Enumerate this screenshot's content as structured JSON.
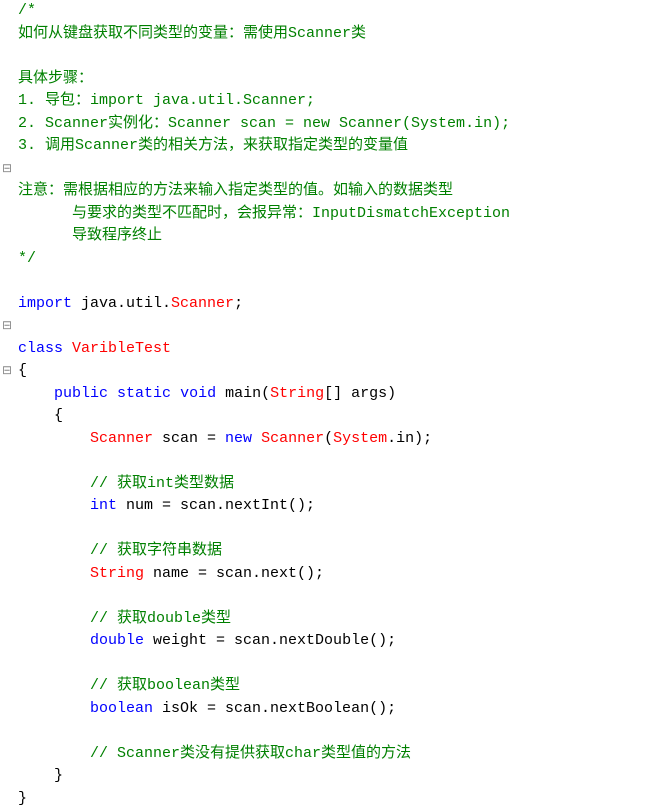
{
  "gutter": [
    "",
    "",
    "",
    "",
    "",
    "",
    "",
    "⊟",
    "",
    "",
    "",
    "",
    "",
    "",
    "⊟",
    "",
    "⊟",
    "",
    "",
    "",
    "",
    "",
    "",
    "",
    "",
    "",
    "",
    "",
    "",
    "",
    "",
    "",
    "",
    "",
    ""
  ],
  "lines": [
    [
      [
        "comment",
        "/*"
      ]
    ],
    [
      [
        "comment",
        "如何从键盘获取不同类型的变量：需使用Scanner类"
      ]
    ],
    [],
    [
      [
        "comment",
        "具体步骤："
      ]
    ],
    [
      [
        "comment",
        "1. 导包：import java.util.Scanner;"
      ]
    ],
    [
      [
        "comment",
        "2. Scanner实例化：Scanner scan = new Scanner(System.in);"
      ]
    ],
    [
      [
        "comment",
        "3. 调用Scanner类的相关方法，来获取指定类型的变量值"
      ]
    ],
    [],
    [
      [
        "comment",
        "注意：需根据相应的方法来输入指定类型的值。如输入的数据类型"
      ]
    ],
    [
      [
        "comment",
        "      与要求的类型不匹配时，会报异常：InputDismatchException"
      ]
    ],
    [
      [
        "comment",
        "      导致程序终止"
      ]
    ],
    [
      [
        "comment",
        "*/"
      ]
    ],
    [],
    [
      [
        "keyword",
        "import"
      ],
      [
        "plain",
        " java.util."
      ],
      [
        "sys",
        "Scanner"
      ],
      [
        "plain",
        ";"
      ]
    ],
    [],
    [
      [
        "keyword",
        "class"
      ],
      [
        "plain",
        " "
      ],
      [
        "sys",
        "VaribleTest"
      ]
    ],
    [
      [
        "plain",
        "{"
      ]
    ],
    [
      [
        "plain",
        "    "
      ],
      [
        "keyword",
        "public"
      ],
      [
        "plain",
        " "
      ],
      [
        "keyword",
        "static"
      ],
      [
        "plain",
        " "
      ],
      [
        "keyword",
        "void"
      ],
      [
        "plain",
        " main("
      ],
      [
        "sys",
        "String"
      ],
      [
        "plain",
        "[] args)"
      ]
    ],
    [
      [
        "plain",
        "    {"
      ]
    ],
    [
      [
        "plain",
        "        "
      ],
      [
        "sys",
        "Scanner"
      ],
      [
        "plain",
        " scan = "
      ],
      [
        "keyword",
        "new"
      ],
      [
        "plain",
        " "
      ],
      [
        "sys",
        "Scanner"
      ],
      [
        "plain",
        "("
      ],
      [
        "sys",
        "System"
      ],
      [
        "plain",
        ".in);"
      ]
    ],
    [],
    [
      [
        "plain",
        "        "
      ],
      [
        "comment",
        "// 获取int类型数据"
      ]
    ],
    [
      [
        "plain",
        "        "
      ],
      [
        "keyword",
        "int"
      ],
      [
        "plain",
        " num = scan.nextInt();"
      ]
    ],
    [],
    [
      [
        "plain",
        "        "
      ],
      [
        "comment",
        "// 获取字符串数据"
      ]
    ],
    [
      [
        "plain",
        "        "
      ],
      [
        "sys",
        "String"
      ],
      [
        "plain",
        " name = scan.next();"
      ]
    ],
    [],
    [
      [
        "plain",
        "        "
      ],
      [
        "comment",
        "// 获取double类型"
      ]
    ],
    [
      [
        "plain",
        "        "
      ],
      [
        "keyword",
        "double"
      ],
      [
        "plain",
        " weight = scan.nextDouble();"
      ]
    ],
    [],
    [
      [
        "plain",
        "        "
      ],
      [
        "comment",
        "// 获取boolean类型"
      ]
    ],
    [
      [
        "plain",
        "        "
      ],
      [
        "keyword",
        "boolean"
      ],
      [
        "plain",
        " isOk = scan.nextBoolean();"
      ]
    ],
    [],
    [
      [
        "plain",
        "        "
      ],
      [
        "comment",
        "// Scanner类没有提供获取char类型值的方法"
      ]
    ],
    [
      [
        "plain",
        "    }"
      ]
    ],
    [
      [
        "plain",
        "}"
      ]
    ]
  ]
}
